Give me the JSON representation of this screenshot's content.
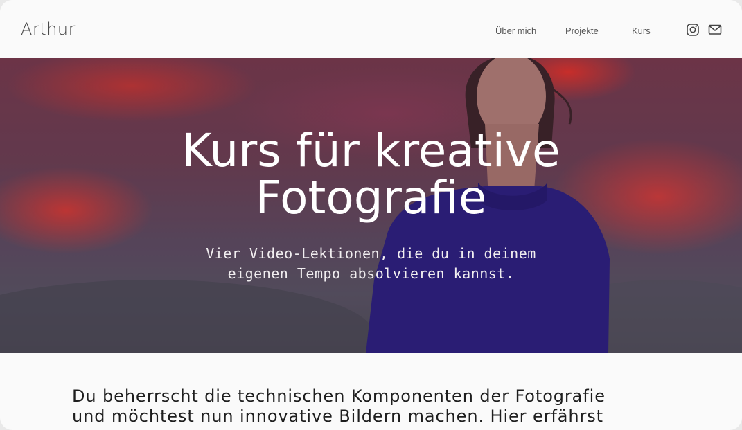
{
  "header": {
    "brand": "Arthur",
    "nav": [
      {
        "label": "Über mich"
      },
      {
        "label": "Projekte"
      },
      {
        "label": "Kurs"
      }
    ],
    "icons": [
      "instagram-icon",
      "mail-icon"
    ]
  },
  "hero": {
    "title_line1": "Kurs für kreative",
    "title_line2": "Fotografie",
    "subtitle_line1": "Vier Video-Lektionen, die du in deinem",
    "subtitle_line2": "eigenen Tempo absolvieren kannst."
  },
  "intro": {
    "line1": "Du beherrscht die technischen Komponenten der Fotografie",
    "line2": "und möchtest nun innovative Bildern machen. Hier erfährst"
  },
  "colors": {
    "accent_red": "#e23a34",
    "sweater": "#2a1e84",
    "text_dark": "#1e1e1e"
  }
}
